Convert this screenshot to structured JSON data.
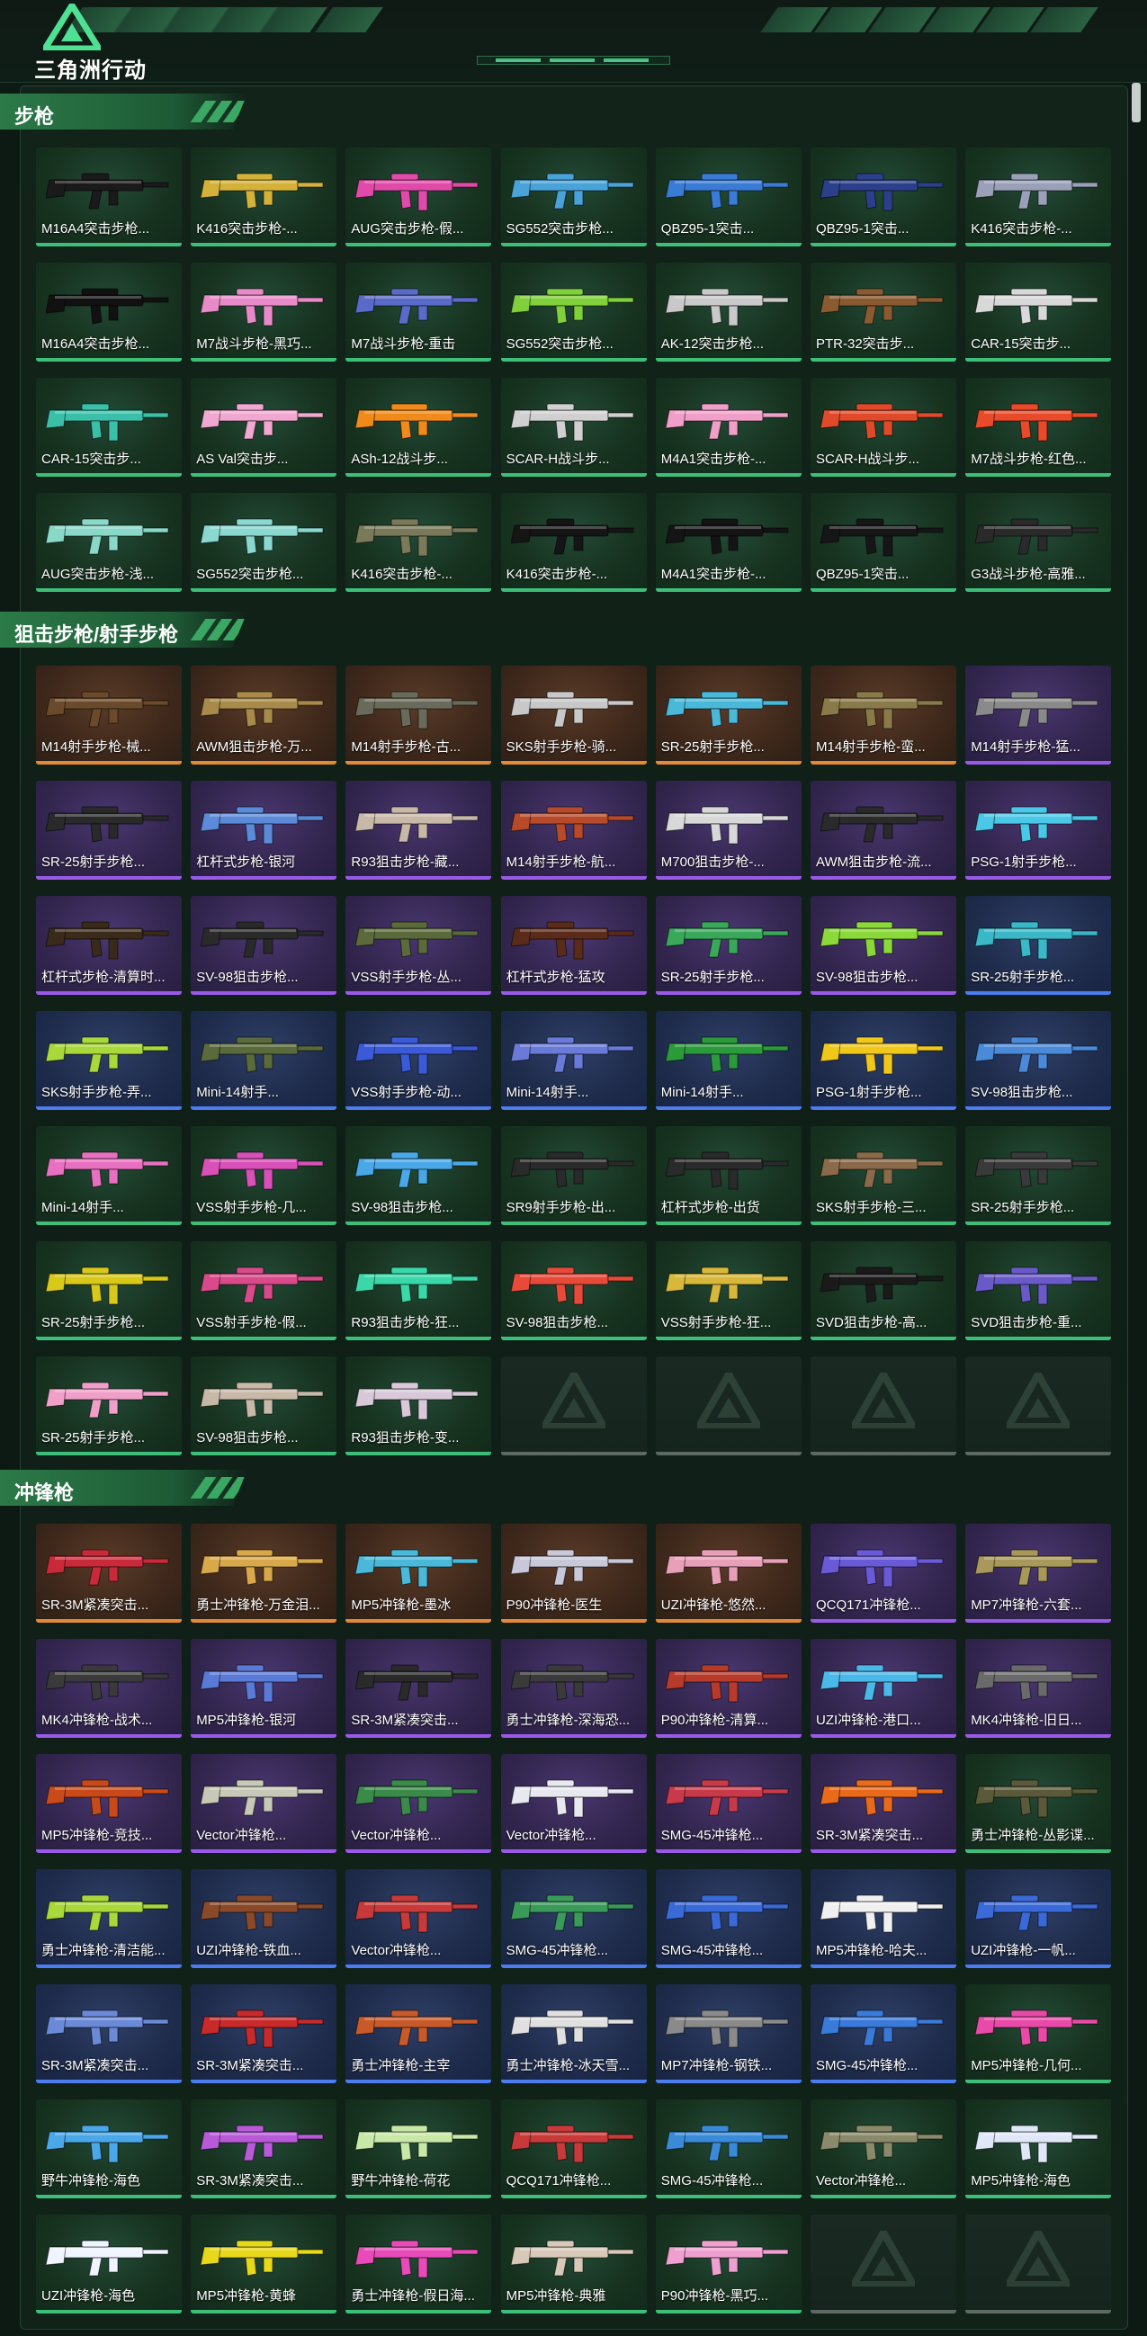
{
  "brand": {
    "name": "三角洲行动"
  },
  "sections": [
    {
      "title": "步枪",
      "items": [
        {
          "name": "M16A4突击步枪...",
          "color": "#1a1a1a",
          "rarity": "common"
        },
        {
          "name": "K416突击步枪-...",
          "color": "#d4b23a",
          "rarity": "common"
        },
        {
          "name": "AUG突击步枪-假...",
          "color": "#e04aa8",
          "rarity": "common"
        },
        {
          "name": "SG552突击步枪...",
          "color": "#4aa3d8",
          "rarity": "common"
        },
        {
          "name": "QBZ95-1突击...",
          "color": "#3a7bd5",
          "rarity": "common"
        },
        {
          "name": "QBZ95-1突击...",
          "color": "#2c3f8a",
          "rarity": "common"
        },
        {
          "name": "K416突击步枪-...",
          "color": "#9aa0b8",
          "rarity": "common"
        },
        {
          "name": "M16A4突击步枪...",
          "color": "#111111",
          "rarity": "common"
        },
        {
          "name": "M7战斗步枪-黑巧...",
          "color": "#e88ac8",
          "rarity": "common"
        },
        {
          "name": "M7战斗步枪-重击",
          "color": "#5a6ac8",
          "rarity": "common"
        },
        {
          "name": "SG552突击步枪...",
          "color": "#7fd03a",
          "rarity": "common"
        },
        {
          "name": "AK-12突击步枪...",
          "color": "#c9c9c9",
          "rarity": "common"
        },
        {
          "name": "PTR-32突击步...",
          "color": "#8a5a30",
          "rarity": "common"
        },
        {
          "name": "CAR-15突击步...",
          "color": "#d8d8d8",
          "rarity": "common"
        },
        {
          "name": "CAR-15突击步...",
          "color": "#3ac0a8",
          "rarity": "common"
        },
        {
          "name": "AS Val突击步...",
          "color": "#f0a8d0",
          "rarity": "common"
        },
        {
          "name": "ASh-12战斗步...",
          "color": "#f08a1a",
          "rarity": "common"
        },
        {
          "name": "SCAR-H战斗步...",
          "color": "#d0d0d0",
          "rarity": "common"
        },
        {
          "name": "M4A1突击步枪-...",
          "color": "#f0a0c8",
          "rarity": "common"
        },
        {
          "name": "SCAR-H战斗步...",
          "color": "#e04a2a",
          "rarity": "common"
        },
        {
          "name": "M7战斗步枪-红色...",
          "color": "#e84a2a",
          "rarity": "common"
        },
        {
          "name": "AUG突击步枪-浅...",
          "color": "#8ad8c8",
          "rarity": "common"
        },
        {
          "name": "SG552突击步枪...",
          "color": "#8ad8d0",
          "rarity": "common"
        },
        {
          "name": "K416突击步枪-...",
          "color": "#7a7a5a",
          "rarity": "common"
        },
        {
          "name": "K416突击步枪-...",
          "color": "#151515",
          "rarity": "common"
        },
        {
          "name": "M4A1突击步枪-...",
          "color": "#141414",
          "rarity": "common"
        },
        {
          "name": "QBZ95-1突击...",
          "color": "#161616",
          "rarity": "common"
        },
        {
          "name": "G3战斗步枪-高雅...",
          "color": "#2a2a2a",
          "rarity": "common"
        }
      ]
    },
    {
      "title": "狙击步枪/射手步枪",
      "items": [
        {
          "name": "M14射手步枪-械...",
          "color": "#6a4a2a",
          "rarity": "legend"
        },
        {
          "name": "AWM狙击步枪-万...",
          "color": "#a88a4a",
          "rarity": "legend"
        },
        {
          "name": "M14射手步枪-古...",
          "color": "#6a6a5a",
          "rarity": "legend"
        },
        {
          "name": "SKS射手步枪-骑...",
          "color": "#c8c8c8",
          "rarity": "legend"
        },
        {
          "name": "SR-25射手步枪...",
          "color": "#4ab8d8",
          "rarity": "legend"
        },
        {
          "name": "M14射手步枪-蛮...",
          "color": "#8a7a4a",
          "rarity": "legend"
        },
        {
          "name": "M14射手步枪-猛...",
          "color": "#8a8a8a",
          "rarity": "epic"
        },
        {
          "name": "SR-25射手步枪...",
          "color": "#2a2a2a",
          "rarity": "epic"
        },
        {
          "name": "杠杆式步枪-银河",
          "color": "#5a8ad8",
          "rarity": "epic"
        },
        {
          "name": "R93狙击步枪-藏...",
          "color": "#c8b8a8",
          "rarity": "epic"
        },
        {
          "name": "M14射手步枪-航...",
          "color": "#b84a2a",
          "rarity": "epic"
        },
        {
          "name": "M700狙击步枪-...",
          "color": "#d8d8d8",
          "rarity": "epic"
        },
        {
          "name": "AWM狙击步枪-流...",
          "color": "#2a2a2a",
          "rarity": "epic"
        },
        {
          "name": "PSG-1射手步枪...",
          "color": "#4ac8e8",
          "rarity": "epic"
        },
        {
          "name": "杠杆式步枪-清算时...",
          "color": "#3a2a1a",
          "rarity": "epic"
        },
        {
          "name": "SV-98狙击步枪...",
          "color": "#2a2a2a",
          "rarity": "epic"
        },
        {
          "name": "VSS射手步枪-丛...",
          "color": "#5a6a3a",
          "rarity": "epic"
        },
        {
          "name": "杠杆式步枪-猛攻",
          "color": "#5a2a1a",
          "rarity": "epic"
        },
        {
          "name": "SR-25射手步枪...",
          "color": "#3aa85a",
          "rarity": "epic"
        },
        {
          "name": "SV-98狙击步枪...",
          "color": "#8ad83a",
          "rarity": "epic"
        },
        {
          "name": "SR-25射手步枪...",
          "color": "#3ab8c8",
          "rarity": "rare"
        },
        {
          "name": "SKS射手步枪-弄...",
          "color": "#a8d83a",
          "rarity": "rare"
        },
        {
          "name": "Mini-14射手...",
          "color": "#5a6a3a",
          "rarity": "rare"
        },
        {
          "name": "VSS射手步枪-动...",
          "color": "#3a5ad8",
          "rarity": "rare"
        },
        {
          "name": "Mini-14射手...",
          "color": "#6a7ad8",
          "rarity": "rare"
        },
        {
          "name": "Mini-14射手...",
          "color": "#2a9a3a",
          "rarity": "rare"
        },
        {
          "name": "PSG-1射手步枪...",
          "color": "#f0c81a",
          "rarity": "rare"
        },
        {
          "name": "SV-98狙击步枪...",
          "color": "#4a8ad8",
          "rarity": "rare"
        },
        {
          "name": "Mini-14射手...",
          "color": "#e870c0",
          "rarity": "common"
        },
        {
          "name": "VSS射手步枪-几...",
          "color": "#d850b8",
          "rarity": "common"
        },
        {
          "name": "SV-98狙击步枪...",
          "color": "#4aa8e8",
          "rarity": "common"
        },
        {
          "name": "SR9射手步枪-出...",
          "color": "#2a2a2a",
          "rarity": "common"
        },
        {
          "name": "杠杆式步枪-出货",
          "color": "#2a2a2a",
          "rarity": "common"
        },
        {
          "name": "SKS射手步枪-三...",
          "color": "#8a6a4a",
          "rarity": "common"
        },
        {
          "name": "SR-25射手步枪...",
          "color": "#3a3a3a",
          "rarity": "common"
        },
        {
          "name": "SR-25射手步枪...",
          "color": "#d8c81a",
          "rarity": "common"
        },
        {
          "name": "VSS射手步枪-假...",
          "color": "#d84a8a",
          "rarity": "common"
        },
        {
          "name": "R93狙击步枪-狂...",
          "color": "#3ad8a8",
          "rarity": "common"
        },
        {
          "name": "SV-98狙击步枪...",
          "color": "#e84a3a",
          "rarity": "common"
        },
        {
          "name": "VSS射手步枪-狂...",
          "color": "#d8b83a",
          "rarity": "common"
        },
        {
          "name": "SVD狙击步枪-高...",
          "color": "#1a1a1a",
          "rarity": "common"
        },
        {
          "name": "SVD狙击步枪-重...",
          "color": "#6a5ac8",
          "rarity": "common"
        },
        {
          "name": "SR-25射手步枪...",
          "color": "#f0a0c8",
          "rarity": "common"
        },
        {
          "name": "SV-98狙击步枪...",
          "color": "#c8b8a8",
          "rarity": "common"
        },
        {
          "name": "R93狙击步枪-变...",
          "color": "#d8c8d8",
          "rarity": "common"
        }
      ],
      "empty_slots": 4
    },
    {
      "title": "冲锋枪",
      "items": [
        {
          "name": "SR-3M紧凑突击...",
          "color": "#c82a3a",
          "rarity": "legend"
        },
        {
          "name": "勇士冲锋枪-万金泪...",
          "color": "#d8a84a",
          "rarity": "legend"
        },
        {
          "name": "MP5冲锋枪-墨冰",
          "color": "#4ab8d8",
          "rarity": "legend"
        },
        {
          "name": "P90冲锋枪-医生",
          "color": "#c8c8d8",
          "rarity": "legend"
        },
        {
          "name": "UZI冲锋枪-悠然...",
          "color": "#e8a0b8",
          "rarity": "legend"
        },
        {
          "name": "QCQ171冲锋枪...",
          "color": "#6a5ad8",
          "rarity": "epic"
        },
        {
          "name": "MP7冲锋枪-六套...",
          "color": "#a8985a",
          "rarity": "epic"
        },
        {
          "name": "MK4冲锋枪-战术...",
          "color": "#3a3a3a",
          "rarity": "epic"
        },
        {
          "name": "MP5冲锋枪-银河",
          "color": "#5a7ad8",
          "rarity": "epic"
        },
        {
          "name": "SR-3M紧凑突击...",
          "color": "#2a2a2a",
          "rarity": "epic"
        },
        {
          "name": "勇士冲锋枪-深海恐...",
          "color": "#3a3a3a",
          "rarity": "epic"
        },
        {
          "name": "P90冲锋枪-清算...",
          "color": "#b83a2a",
          "rarity": "epic"
        },
        {
          "name": "UZI冲锋枪-港口...",
          "color": "#4ab8e8",
          "rarity": "epic"
        },
        {
          "name": "MK4冲锋枪-旧日...",
          "color": "#6a6a6a",
          "rarity": "epic"
        },
        {
          "name": "MP5冲锋枪-竞技...",
          "color": "#c84a1a",
          "rarity": "epic"
        },
        {
          "name": "Vector冲锋枪...",
          "color": "#c8c8b8",
          "rarity": "epic"
        },
        {
          "name": "Vector冲锋枪...",
          "color": "#3a8a4a",
          "rarity": "epic"
        },
        {
          "name": "Vector冲锋枪...",
          "color": "#e8e8f0",
          "rarity": "epic"
        },
        {
          "name": "SMG-45冲锋枪...",
          "color": "#c83a4a",
          "rarity": "epic"
        },
        {
          "name": "SR-3M紧凑突击...",
          "color": "#e86a1a",
          "rarity": "epic"
        },
        {
          "name": "勇士冲锋枪-丛影谍...",
          "color": "#5a5a3a",
          "rarity": "common"
        },
        {
          "name": "勇士冲锋枪-清洁能...",
          "color": "#a8d83a",
          "rarity": "rare"
        },
        {
          "name": "UZI冲锋枪-铁血...",
          "color": "#8a4a2a",
          "rarity": "rare"
        },
        {
          "name": "Vector冲锋枪...",
          "color": "#c83a3a",
          "rarity": "rare"
        },
        {
          "name": "SMG-45冲锋枪...",
          "color": "#3a9a5a",
          "rarity": "rare"
        },
        {
          "name": "SMG-45冲锋枪...",
          "color": "#3a6ad8",
          "rarity": "rare"
        },
        {
          "name": "MP5冲锋枪-哈夫...",
          "color": "#f0f0f0",
          "rarity": "rare"
        },
        {
          "name": "UZI冲锋枪-一帆...",
          "color": "#3a6ad8",
          "rarity": "rare"
        },
        {
          "name": "SR-3M紧凑突击...",
          "color": "#6a8ad8",
          "rarity": "rare"
        },
        {
          "name": "SR-3M紧凑突击...",
          "color": "#c82a2a",
          "rarity": "rare"
        },
        {
          "name": "勇士冲锋枪-主宰",
          "color": "#c85a2a",
          "rarity": "rare"
        },
        {
          "name": "勇士冲锋枪-冰天雪...",
          "color": "#e0e0e0",
          "rarity": "rare"
        },
        {
          "name": "MP7冲锋枪-钢铁...",
          "color": "#8a8a8a",
          "rarity": "rare"
        },
        {
          "name": "SMG-45冲锋枪...",
          "color": "#3a7ad8",
          "rarity": "rare"
        },
        {
          "name": "MP5冲锋枪-几何...",
          "color": "#e84aa8",
          "rarity": "common"
        },
        {
          "name": "野牛冲锋枪-海色",
          "color": "#4aa8e8",
          "rarity": "common"
        },
        {
          "name": "SR-3M紧凑突击...",
          "color": "#b85ad8",
          "rarity": "common"
        },
        {
          "name": "野牛冲锋枪-荷花",
          "color": "#c8e8a8",
          "rarity": "common"
        },
        {
          "name": "QCQ171冲锋枪...",
          "color": "#c83a3a",
          "rarity": "common"
        },
        {
          "name": "SMG-45冲锋枪...",
          "color": "#3a8ad8",
          "rarity": "common"
        },
        {
          "name": "Vector冲锋枪...",
          "color": "#8a8a6a",
          "rarity": "common"
        },
        {
          "name": "MP5冲锋枪-海色",
          "color": "#e0e8f8",
          "rarity": "common"
        },
        {
          "name": "UZI冲锋枪-海色",
          "color": "#f0f4ff",
          "rarity": "common"
        },
        {
          "name": "MP5冲锋枪-黄蜂",
          "color": "#e8d81a",
          "rarity": "common"
        },
        {
          "name": "勇士冲锋枪-假日海...",
          "color": "#e84ab8",
          "rarity": "common"
        },
        {
          "name": "MP5冲锋枪-典雅",
          "color": "#d8c8b8",
          "rarity": "common"
        },
        {
          "name": "P90冲锋枪-黑巧...",
          "color": "#f0a0d0",
          "rarity": "common"
        }
      ],
      "empty_slots": 2
    }
  ]
}
